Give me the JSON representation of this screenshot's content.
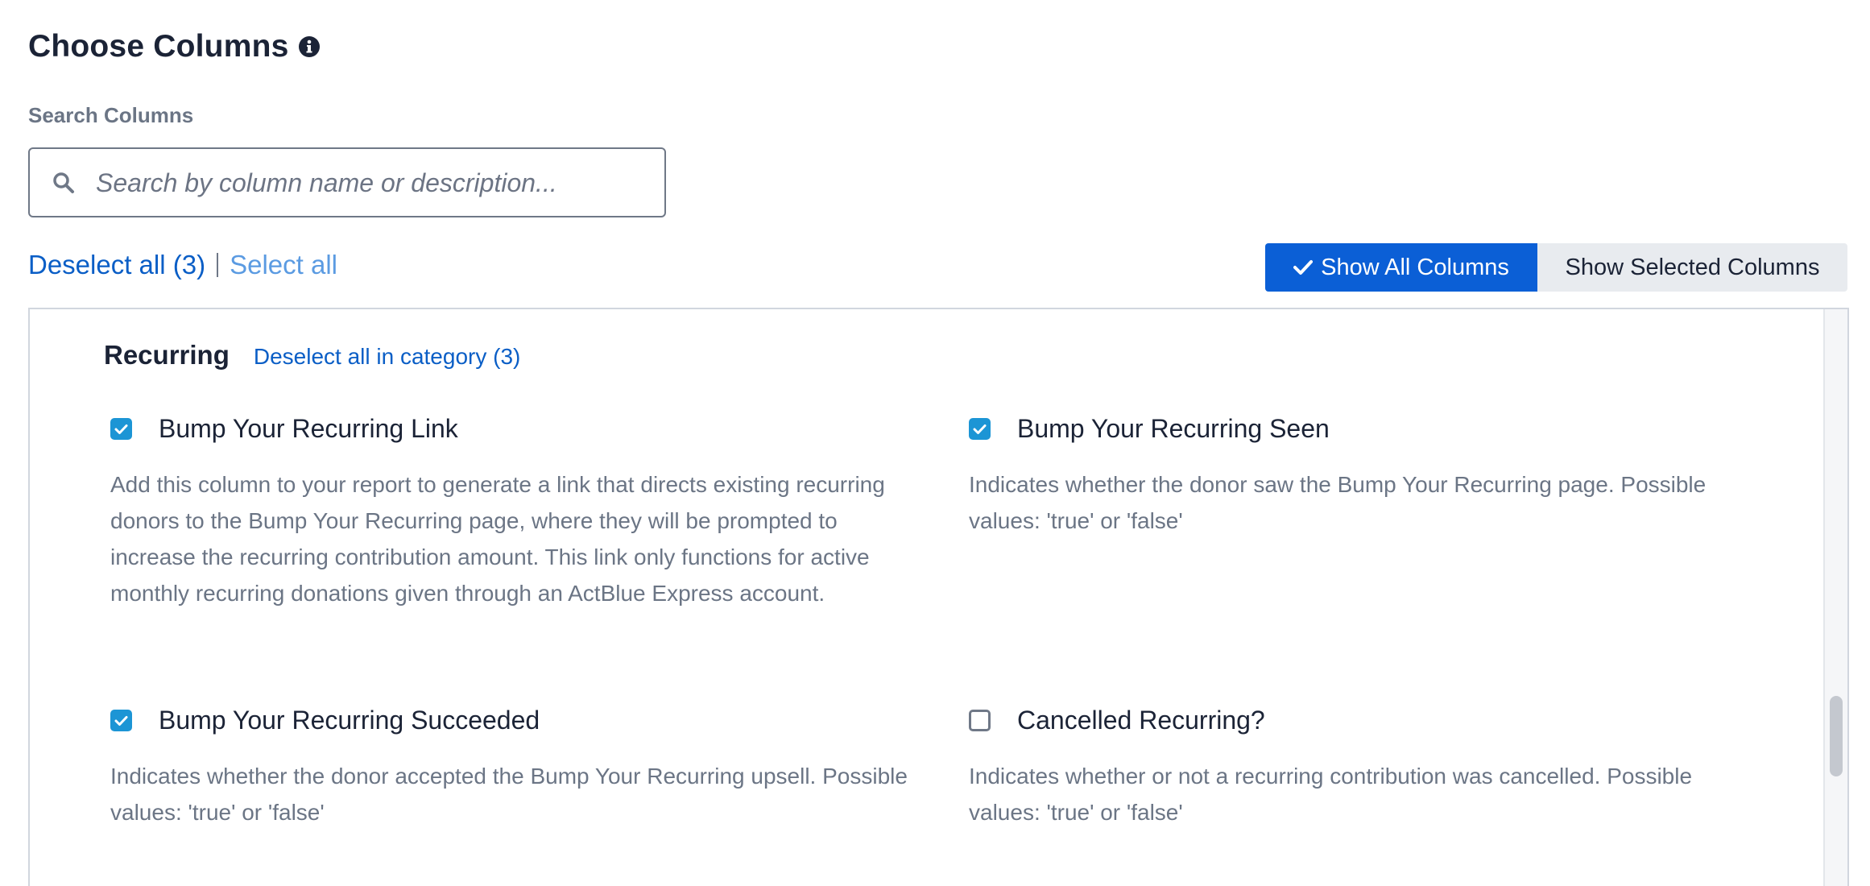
{
  "header": {
    "title": "Choose Columns"
  },
  "search": {
    "label": "Search Columns",
    "placeholder": "Search by column name or description...",
    "value": ""
  },
  "selection": {
    "deselect_all": "Deselect all (3)",
    "select_all": "Select all"
  },
  "view_toggle": {
    "show_all": "Show All Columns",
    "show_selected": "Show Selected Columns",
    "active": "show_all"
  },
  "category": {
    "title": "Recurring",
    "deselect_link": "Deselect all in category (3)",
    "items": [
      {
        "name": "Bump Your Recurring Link",
        "checked": true,
        "description": "Add this column to your report to generate a link that directs existing recurring donors to the Bump Your Recurring page, where they will be prompted to increase the recurring contribution amount. This link only functions for active monthly recurring donations given through an ActBlue Express account."
      },
      {
        "name": "Bump Your Recurring Seen",
        "checked": true,
        "description": "Indicates whether the donor saw the Bump Your Recurring page. Possible values: 'true' or 'false'"
      },
      {
        "name": "Bump Your Recurring Succeeded",
        "checked": true,
        "description": "Indicates whether the donor accepted the Bump Your Recurring upsell. Possible values: 'true' or 'false'"
      },
      {
        "name": "Cancelled Recurring?",
        "checked": false,
        "description": "Indicates whether or not a recurring contribution was cancelled. Possible values: 'true' or 'false'"
      }
    ]
  },
  "colors": {
    "primary": "#0b5fd6",
    "checkbox": "#1c95d5",
    "link": "#0a5ec6",
    "muted_text": "#6b7585"
  },
  "icons": {
    "info": "info-icon",
    "search": "search-icon",
    "check": "check-icon"
  }
}
